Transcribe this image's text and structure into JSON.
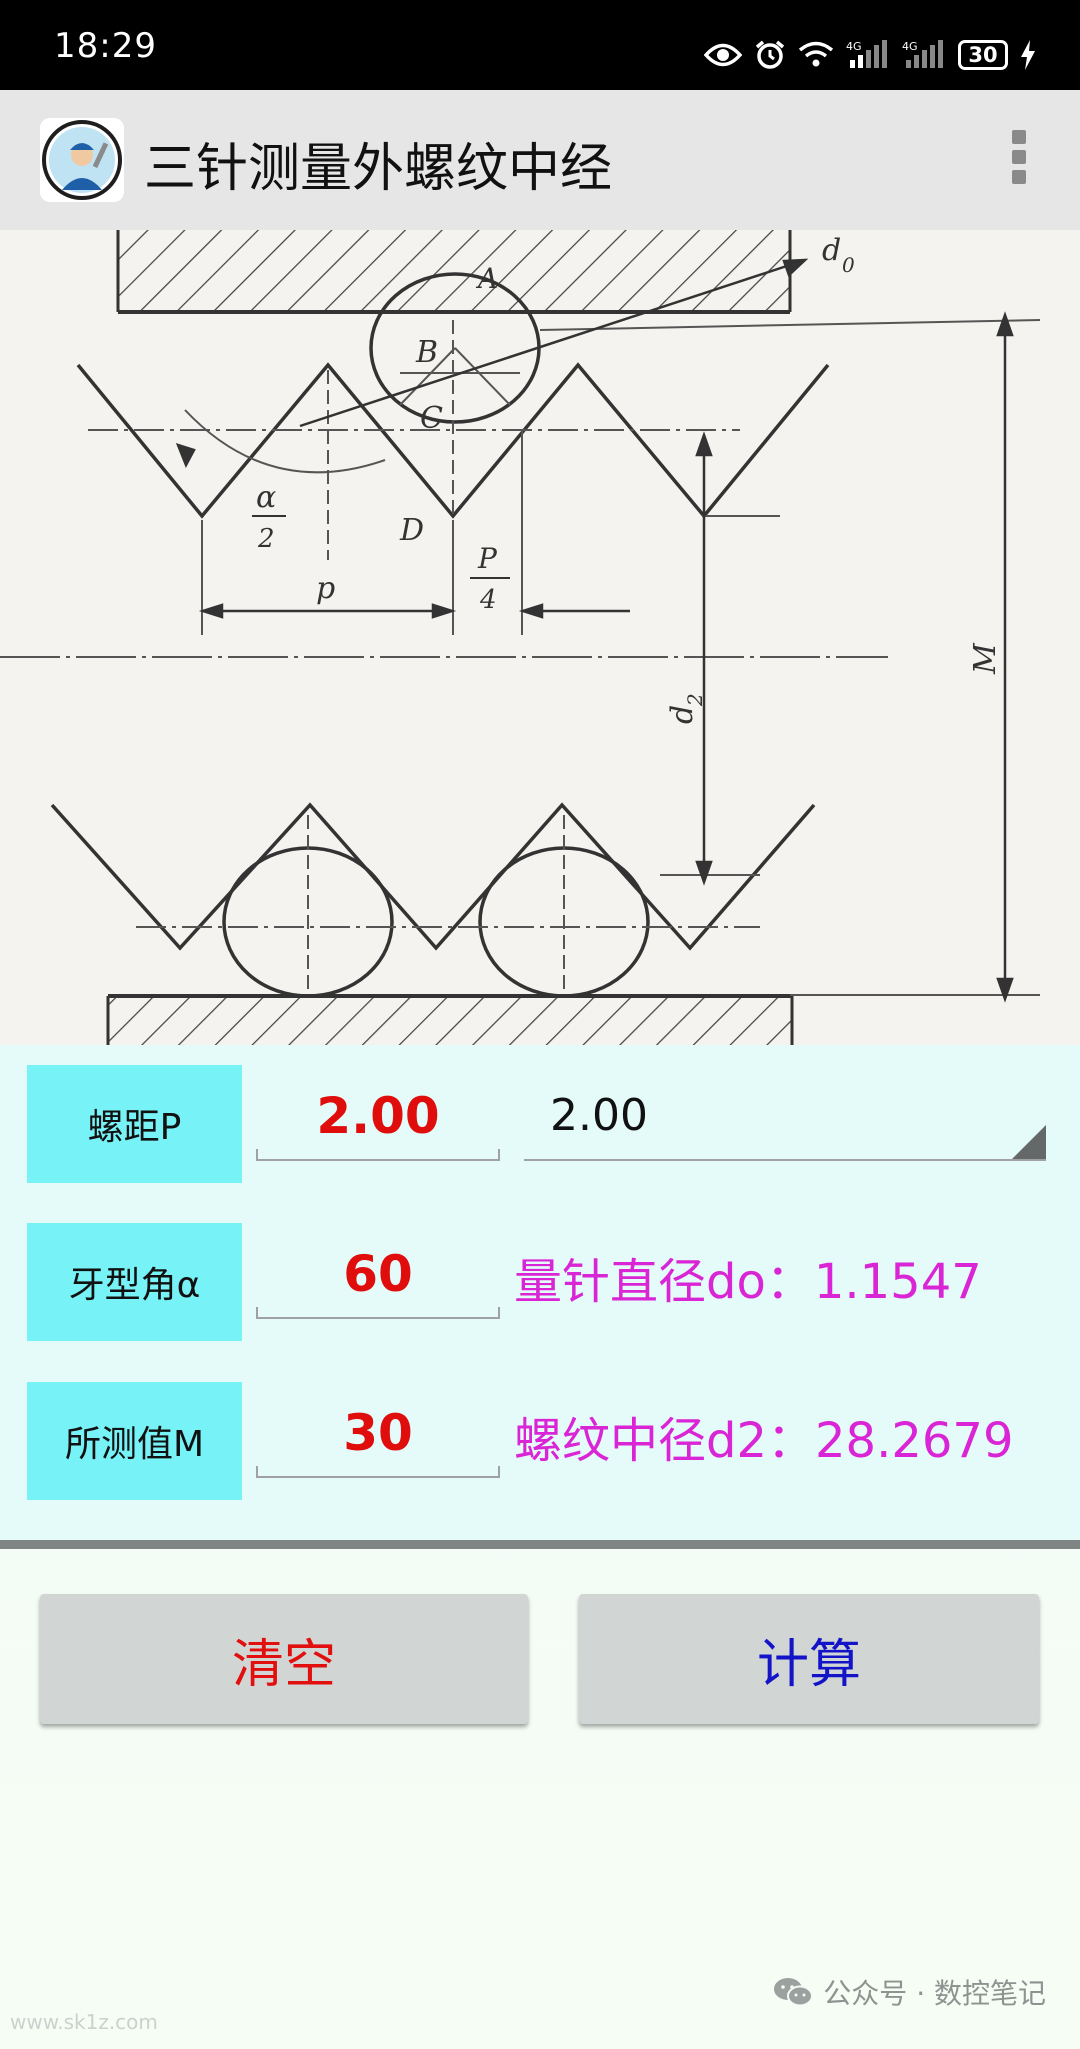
{
  "status_bar": {
    "time": "18:29",
    "battery": "30",
    "signal_1": "4G",
    "signal_2": "4G"
  },
  "app_bar": {
    "title": "三针测量外螺纹中经",
    "icon": "mechanic-avatar-icon",
    "menu_icon": "more-vert-icon"
  },
  "diagram": {
    "labels": {
      "A": "A",
      "B": "B",
      "C": "C",
      "D": "D",
      "d0": "d",
      "d0_sub": "0",
      "alpha": "α",
      "two": "2",
      "p": "p",
      "P": "P",
      "four": "4",
      "d2": "d",
      "d2_sub": "2",
      "M": "M"
    }
  },
  "form": {
    "pitch": {
      "label": "螺距P",
      "value": "2.00",
      "dropdown_selected": "2.00"
    },
    "angle": {
      "label": "牙型角α",
      "value": "60",
      "result": "量针直径do：1.1547"
    },
    "measured": {
      "label": "所测值M",
      "value": "30",
      "result": "螺纹中径d2：28.2679"
    }
  },
  "buttons": {
    "clear": "清空",
    "calculate": "计算"
  },
  "watermark": {
    "left": "www.sk1z.com",
    "right": "公众号 · 数控笔记"
  },
  "colors": {
    "label_bg": "#77f2f7",
    "value_red": "#e00d0d",
    "result_magenta": "#d925d5",
    "clear_red": "#e20f0f",
    "calc_blue": "#1313c8"
  }
}
